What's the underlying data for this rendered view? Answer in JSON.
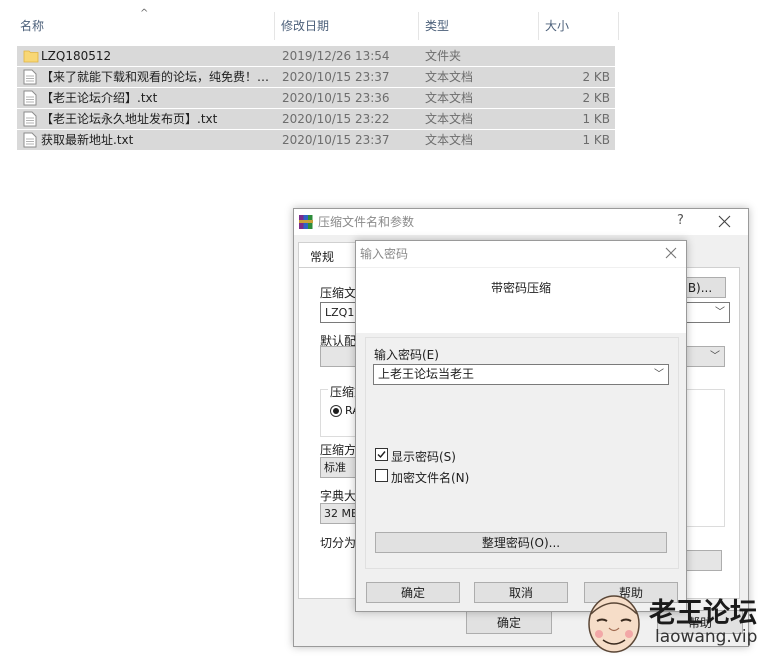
{
  "explorer": {
    "columns": {
      "name": "名称",
      "date": "修改日期",
      "type": "类型",
      "size": "大小"
    },
    "files": [
      {
        "name": "LZQ180512",
        "date": "2019/12/26 13:54",
        "type": "文件夹",
        "size": "",
        "icon": "folder-icon"
      },
      {
        "name": "【来了就能下载和观看的论坛，纯免费！…",
        "date": "2020/10/15 23:37",
        "type": "文本文档",
        "size": "2 KB",
        "icon": "text-file-icon"
      },
      {
        "name": "【老王论坛介绍】.txt",
        "date": "2020/10/15 23:36",
        "type": "文本文档",
        "size": "2 KB",
        "icon": "text-file-icon"
      },
      {
        "name": "【老王论坛永久地址发布页】.txt",
        "date": "2020/10/15 23:22",
        "type": "文本文档",
        "size": "1 KB",
        "icon": "text-file-icon"
      },
      {
        "name": "获取最新地址.txt",
        "date": "2020/10/15 23:37",
        "type": "文本文档",
        "size": "1 KB",
        "icon": "text-file-icon"
      }
    ]
  },
  "archive_dialog": {
    "title": "压缩文件名和参数",
    "help_glyph": "?",
    "tab_general": "常规",
    "archive_name_label": "压缩文",
    "archive_name_value": "LZQ18",
    "browse_label": "B)...",
    "default_profile_label": "默认配",
    "format_group_label": "压缩文",
    "format_option": "RA",
    "method_label": "压缩方",
    "method_value": "标准",
    "dict_label": "字典大",
    "dict_value": "32 MB",
    "split_label": "切分为",
    "ok_label": "确定",
    "help_label": "帮助"
  },
  "password_dialog": {
    "title": "输入密码",
    "heading": "带密码压缩",
    "password_label": "输入密码(E)",
    "password_value": "上老王论坛当老王",
    "show_password_label": "显示密码(S)",
    "show_password_checked": true,
    "encrypt_names_label": "加密文件名(N)",
    "encrypt_names_checked": false,
    "organize_label": "整理密码(O)...",
    "ok_label": "确定",
    "cancel_label": "取消",
    "help_label": "帮助"
  },
  "watermark": {
    "brand": "老王论坛",
    "url": "laowang.vip"
  }
}
